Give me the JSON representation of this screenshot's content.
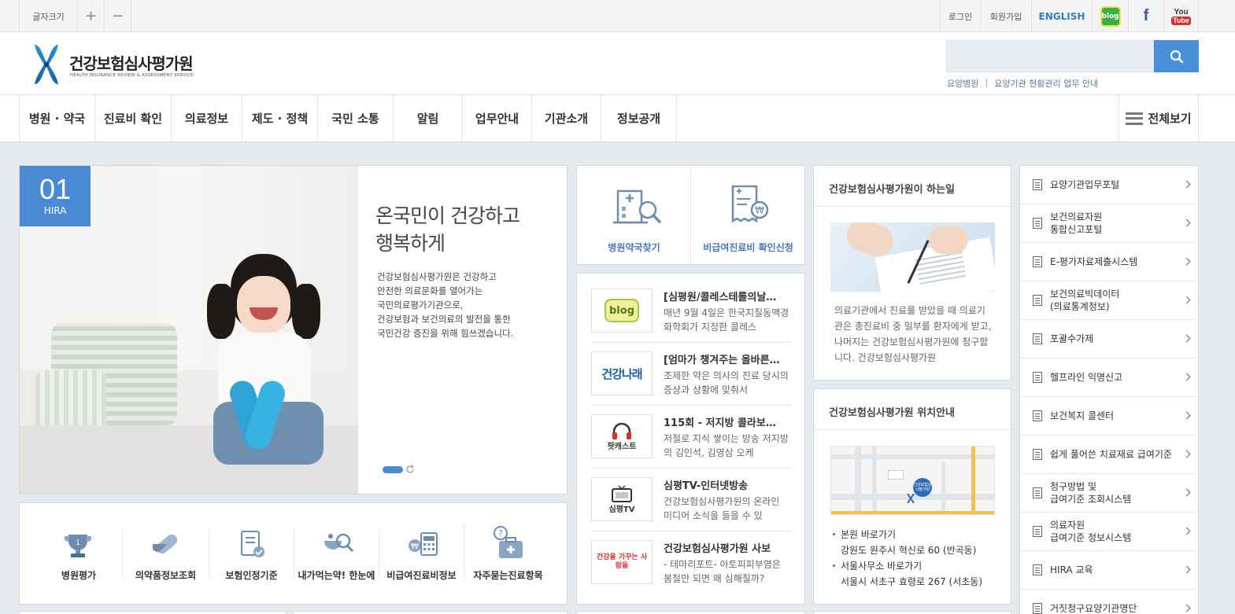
{
  "topbar": {
    "font_size_label": "글자크기",
    "plus": "+",
    "minus": "−",
    "login": "로그인",
    "signup": "회원가입",
    "english": "ENGLISH",
    "blog_icon_text": "blog",
    "facebook_icon_text": "f",
    "youtube_icon_text_1": "You",
    "youtube_icon_text_2": "Tube"
  },
  "header": {
    "logo_title": "건강보험심사평가원",
    "logo_subtitle": "HEALTH INSURANCE REVIEW & ASSESSMENT SERVICE",
    "search_placeholder": "",
    "sub_link_1": "요양병원",
    "sub_separator": "|",
    "sub_link_2": "요양기관 현황관리 업무 안내"
  },
  "gnb": {
    "items": [
      "병원 · 약국",
      "진료비 확인",
      "의료정보",
      "제도 · 정책",
      "국민 소통",
      "알림",
      "업무안내",
      "기관소개",
      "정보공개"
    ],
    "all_menu": "전체보기"
  },
  "hero": {
    "badge_number": "01",
    "badge_label": "HIRA",
    "title_line1": "온국민이 건강하고",
    "title_line2": "행복하게",
    "desc": [
      "건강보험심사평가원은 건강하고",
      "안전한 의료문화를 열어가는",
      "국민의료평가기관으로,",
      "건강보험과 보건의료의 발전을 통한",
      "국민건강 증진을 위해 힘쓰겠습니다."
    ]
  },
  "quick_icons": [
    "병원평가",
    "의약품정보조회",
    "보험인정기준",
    "내가먹는약! 한눈에",
    "비급여진료비정보",
    "자주묻는진료항목"
  ],
  "top_services": {
    "find_hospital": "병원약국찾기",
    "nonpay_check": "비급여진료비 확인신청"
  },
  "news": [
    {
      "thumb": "blog",
      "title": "[심평원/콜레스테롤의날…",
      "desc": "매년 9월 4일은 한국지질동맥경화학회가 지정한 콜레스"
    },
    {
      "thumb": "건강나래",
      "title": "[엄마가 챙겨주는 올바른…",
      "desc": "조제한 약은 의사의 진료 당시의 증상과 상황에 맞춰서"
    },
    {
      "thumb": "팟캐스트",
      "title": "115회 - 저지방 콜라보…",
      "desc": "저절로 지식 쌓이는 방송 저지방의 김인석, 김영삼 오케"
    },
    {
      "thumb": "심평TV",
      "title": "심평TV-인터넷방송",
      "desc": "건강보험심사평가원의 온라인 미디어 소식을 들을 수 있"
    },
    {
      "thumb": "건강을 가꾸는 사람들",
      "title": "건강보험심사평가원 사보",
      "desc": "- 테마리포트- 아토피피부염은 봄철만 되면 왜 심해질까?"
    }
  ],
  "about": {
    "title": "건강보험심사평가원이 하는일",
    "desc": "의료기관에서 진료를 받았을 때 의료기관은 총진료비 중 일부를 환자에게 받고, 나머지는 건강보험심사평가원에 청구합니다. 건강보험심사평가원"
  },
  "location": {
    "title": "건강보험심사평가원 위치안내",
    "map_label": "건강보험심사평가원",
    "hq_link": "본원 바로가기",
    "hq_addr": "강원도 원주시 혁신로 60 (반곡동)",
    "seoul_link": "서울사무소 바로가기",
    "seoul_addr": "서울시 서초구 효령로 267 (서초동)"
  },
  "links": [
    [
      "요양기관업무포털"
    ],
    [
      "보건의료자원",
      "통합신고포털"
    ],
    [
      "E-평가자료제출시스템"
    ],
    [
      "보건의료빅데이터",
      "(의료통계정보)"
    ],
    [
      "포괄수가제"
    ],
    [
      "헬프라인 익명신고"
    ],
    [
      "보건복지 콜센터"
    ],
    [
      "쉽게 풀어쓴 치료재료 급여기준"
    ],
    [
      "청구방법 및",
      "급여기준 조회시스템"
    ],
    [
      "의료자원",
      "급여기준 정보시스템"
    ],
    [
      "HIRA 교육"
    ],
    [
      "거짓청구요양기관명단"
    ]
  ],
  "colors": {
    "accent_blue": "#4a90d9",
    "badge_blue": "#4a8ad4",
    "page_bg": "#e6eaef"
  }
}
